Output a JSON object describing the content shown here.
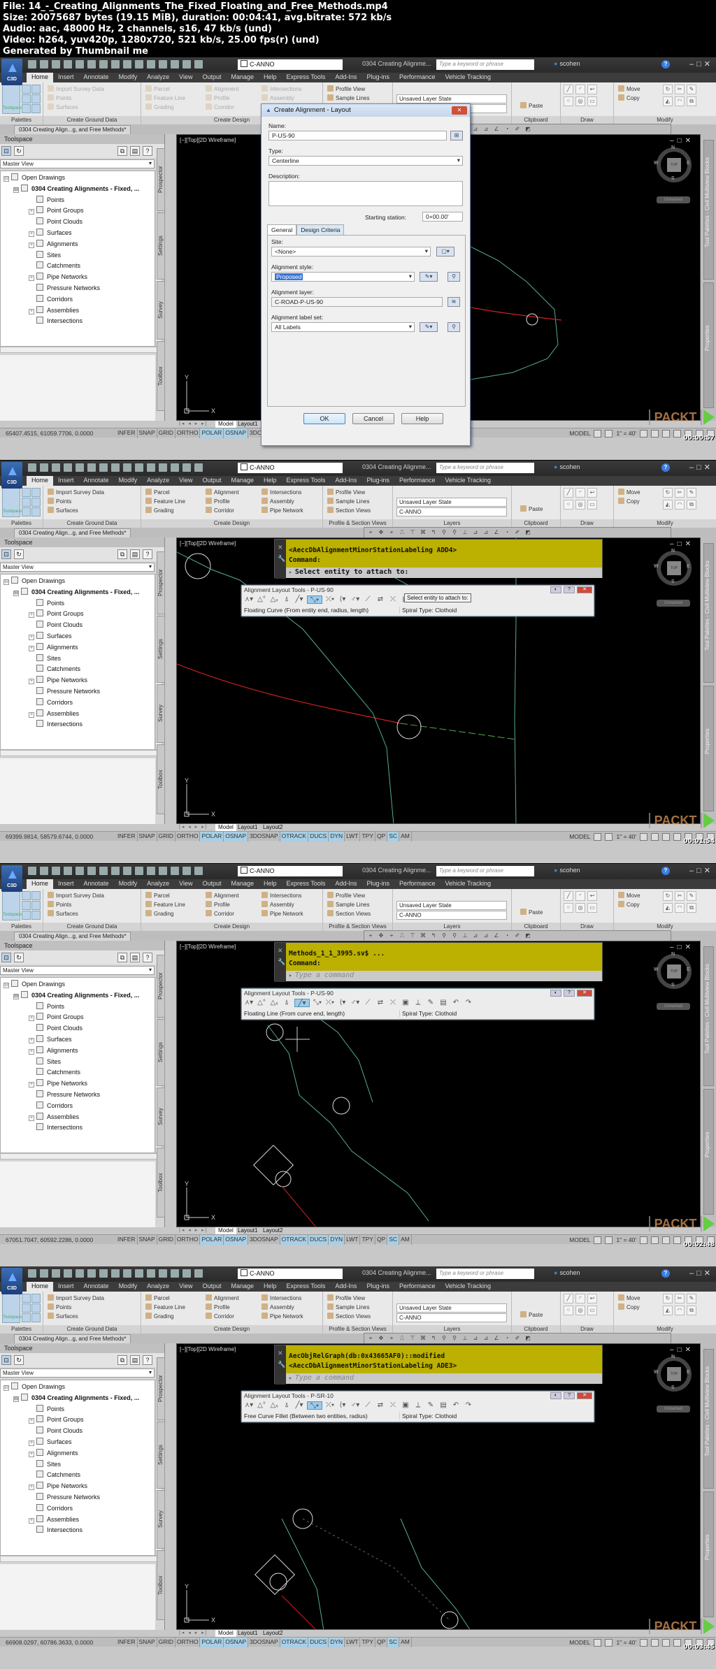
{
  "header": {
    "file": "File: 14_-_Creating_Alignments_The_Fixed_Floating_and_Free_Methods.mp4",
    "size": "Size: 20075687 bytes (19.15 MiB), duration: 00:04:41, avg.bitrate: 572 kb/s",
    "audio": "Audio: aac, 48000 Hz, 2 channels, s16, 47 kb/s (und)",
    "video": "Video: h264, yuv420p, 1280x720, 521 kb/s, 25.00 fps(r) (und)",
    "generator": "Generated by Thumbnail me"
  },
  "app": {
    "logo_label": "C3D",
    "layer_combo": "C-ANNO",
    "doc_title": "0304 Creating Alignme...",
    "search_placeholder": "Type a keyword or phrase",
    "user": "scohen",
    "menu_tabs": [
      "Home",
      "Insert",
      "Annotate",
      "Modify",
      "Analyze",
      "View",
      "Output",
      "Manage",
      "Help",
      "Express Tools",
      "Add-Ins",
      "Plug-ins",
      "Performance",
      "Vehicle Tracking"
    ],
    "ribbon": {
      "toolspace": "Toolspace",
      "palettes": "Palettes",
      "create_ground_data": "Create Ground Data",
      "import_survey_data": "Import Survey Data",
      "points": "Points",
      "surfaces": "Surfaces",
      "parcel": "Parcel",
      "feature_line": "Feature Line",
      "grading": "Grading",
      "alignment": "Alignment",
      "profile": "Profile",
      "corridor": "Corridor",
      "intersections": "Intersections",
      "assembly": "Assembly",
      "pipe_network": "Pipe Network",
      "create_design": "Create Design",
      "profile_view": "Profile View",
      "sample_lines": "Sample Lines",
      "section_views": "Section Views",
      "profile_section_views": "Profile & Section Views",
      "layer_state": "Unsaved Layer State",
      "layers": "Layers",
      "paste": "Paste",
      "clipboard": "Clipboard",
      "draw": "Draw",
      "move": "Move",
      "copy": "Copy",
      "modify": "Modify"
    },
    "file_tab": "0304 Creating Align...g, and Free Methods*",
    "toolspace": {
      "title": "Toolspace",
      "view": "Master View",
      "tree": [
        {
          "label": "Open Drawings",
          "level": 0,
          "exp": true
        },
        {
          "label": "0304 Creating Alignments - Fixed, ...",
          "level": 1,
          "exp": true
        },
        {
          "label": "Points",
          "level": 2,
          "exp": false
        },
        {
          "label": "Point Groups",
          "level": 2,
          "exp": true
        },
        {
          "label": "Point Clouds",
          "level": 2,
          "exp": false
        },
        {
          "label": "Surfaces",
          "level": 2,
          "exp": true
        },
        {
          "label": "Alignments",
          "level": 2,
          "exp": true
        },
        {
          "label": "Sites",
          "level": 2,
          "exp": false
        },
        {
          "label": "Catchments",
          "level": 2,
          "exp": false
        },
        {
          "label": "Pipe Networks",
          "level": 2,
          "exp": true
        },
        {
          "label": "Pressure Networks",
          "level": 2,
          "exp": false
        },
        {
          "label": "Corridors",
          "level": 2,
          "exp": false
        },
        {
          "label": "Assemblies",
          "level": 2,
          "exp": true
        },
        {
          "label": "Intersections",
          "level": 2,
          "exp": false
        }
      ],
      "side_tabs": [
        "Prospector",
        "Settings",
        "Survey",
        "Toolbox"
      ]
    },
    "viewport_label": "[−][Top][2D Wireframe]",
    "viewcube": {
      "top": "TOP",
      "n": "N",
      "s": "S",
      "e": "E",
      "w": "W",
      "ucs": "Unnamed"
    },
    "right_palettes": [
      "Tool Palettes - Civil Multiview Blocks",
      "Properties"
    ],
    "layout_tabs": [
      "Model",
      "Layout1",
      "Layout2"
    ],
    "status_toggles": [
      "INFER",
      "SNAP",
      "GRID",
      "ORTHO",
      "POLAR",
      "OSNAP",
      "3DOSNAP",
      "OTRACK",
      "DUCS",
      "DYN",
      "LWT",
      "TPY",
      "QP",
      "SC",
      "AM"
    ],
    "status_on": [
      "POLAR",
      "OSNAP",
      "OTRACK",
      "DUCS",
      "DYN",
      "SC"
    ],
    "model_label": "MODEL",
    "scale": "1\" = 40'",
    "watermark": "PACKT"
  },
  "frames": [
    {
      "coords": "65407.4515, 61059.7706, 0.0000",
      "timestamp": "00:00:57",
      "dialog": {
        "title": "Create Alignment - Layout",
        "name_label": "Name:",
        "name_value": "P-US-90",
        "type_label": "Type:",
        "type_value": "Centerline",
        "description_label": "Description:",
        "starting_station_label": "Starting station:",
        "starting_station_value": "0+00.00'",
        "tab_general": "General",
        "tab_design_criteria": "Design Criteria",
        "site_label": "Site:",
        "site_value": "<None>",
        "style_label": "Alignment style:",
        "style_value": "Proposed",
        "layer_label": "Alignment layer:",
        "layer_value": "C-ROAD-P-US-90",
        "labelset_label": "Alignment label set:",
        "labelset_value": "All Labels",
        "ok": "OK",
        "cancel": "Cancel",
        "help": "Help"
      }
    },
    {
      "coords": "69399.9814, 58579.6744, 0.0000",
      "timestamp": "00:01:54",
      "cmd_line1": "<AeccDbAlignmentMinorStationLabeling ADD4>",
      "cmd_line2": "Command:",
      "cmd_prompt": "Select entity to attach to:",
      "tools_title": "Alignment Layout Tools - P-US-90",
      "tools_status": "Floating Curve (From entity end, radius, length)",
      "spiral": "Spiral Type: Clothoid",
      "tooltip": "Select entity to attach to:"
    },
    {
      "coords": "67051.7047, 60592.2286, 0.0000",
      "timestamp": "00:02:48",
      "cmd_line1": "Methods_1_1_3995.sv$ ...",
      "cmd_line2": "Command:",
      "cmd_prompt": "Type a command",
      "tools_title": "Alignment Layout Tools - P-US-90",
      "tools_status": "Floating Line (From curve end, length)",
      "spiral": "Spiral Type: Clothoid"
    },
    {
      "coords": "66908.0297, 60786.3633, 0.0000",
      "timestamp": "00:03:45",
      "cmd_line1": "AecObjRelGraph(db:0x43665AF0)::modified",
      "cmd_line2": "<AeccDbAlignmentMinorStationLabeling ADE3>",
      "cmd_prompt": "Type a command",
      "tools_title": "Alignment Layout Tools - P-SR-10",
      "tools_status": "Free Curve Fillet (Between two entities, radius)",
      "spiral": "Spiral Type: Clothoid"
    }
  ]
}
